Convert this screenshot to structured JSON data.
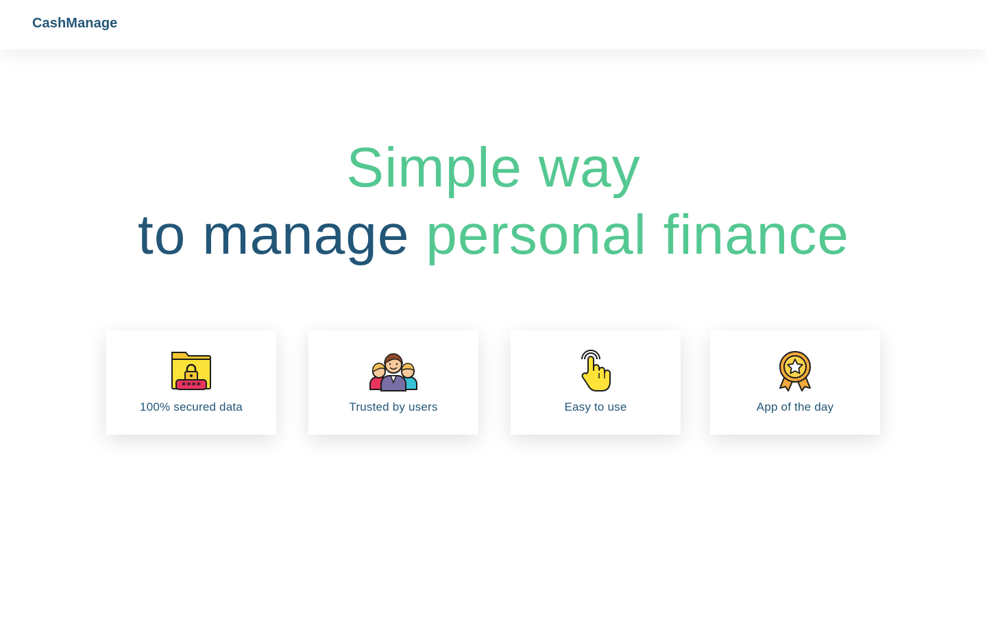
{
  "nav": {
    "brand": "CashManage"
  },
  "hero": {
    "line1": "Simple way",
    "line2_part1": "to manage",
    "line2_part2": "personal finance"
  },
  "colors": {
    "brand_navy": "#235677",
    "accent_green": "#55c892"
  },
  "features": [
    {
      "label": "100% secured data",
      "icon": "secure-folder-icon"
    },
    {
      "label": "Trusted by users",
      "icon": "users-group-icon"
    },
    {
      "label": "Easy to use",
      "icon": "touch-hand-icon"
    },
    {
      "label": "App of the day",
      "icon": "award-medal-icon"
    }
  ]
}
